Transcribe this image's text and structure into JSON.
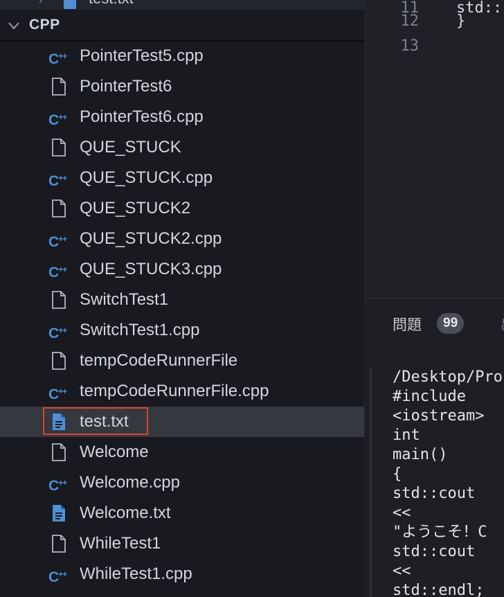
{
  "explorer": {
    "top_item": {
      "label": "test.txt"
    },
    "section": {
      "title": "CPP"
    },
    "files": [
      {
        "label": "PointerTest5.cpp",
        "icon": "cpp-icon"
      },
      {
        "label": "PointerTest6",
        "icon": "file-icon"
      },
      {
        "label": "PointerTest6.cpp",
        "icon": "cpp-icon"
      },
      {
        "label": "QUE_STUCK",
        "icon": "file-icon"
      },
      {
        "label": "QUE_STUCK.cpp",
        "icon": "cpp-icon"
      },
      {
        "label": "QUE_STUCK2",
        "icon": "file-icon"
      },
      {
        "label": "QUE_STUCK2.cpp",
        "icon": "cpp-icon"
      },
      {
        "label": "QUE_STUCK3.cpp",
        "icon": "cpp-icon"
      },
      {
        "label": "SwitchTest1",
        "icon": "file-icon"
      },
      {
        "label": "SwitchTest1.cpp",
        "icon": "cpp-icon"
      },
      {
        "label": "tempCodeRunnerFile",
        "icon": "file-icon"
      },
      {
        "label": "tempCodeRunnerFile.cpp",
        "icon": "cpp-icon"
      },
      {
        "label": "test.txt",
        "icon": "text-file-icon",
        "selected": true
      },
      {
        "label": "Welcome",
        "icon": "file-icon"
      },
      {
        "label": "Welcome.cpp",
        "icon": "cpp-icon"
      },
      {
        "label": "Welcome.txt",
        "icon": "text-file-icon"
      },
      {
        "label": "WhileTest1",
        "icon": "file-icon"
      },
      {
        "label": "WhileTest1.cpp",
        "icon": "cpp-icon"
      }
    ]
  },
  "editor": {
    "lines": [
      {
        "num": "11",
        "code": "std::"
      },
      {
        "num": "12",
        "code": "}"
      },
      {
        "num": "13",
        "code": ""
      }
    ]
  },
  "panel": {
    "tab_label": "問題",
    "badge": "99",
    "tab2_label": "出",
    "terminal_lines": [
      "/Desktop/Pro",
      "#include",
      "<iostream>",
      "int",
      "main()",
      "{",
      "std::cout",
      "<<",
      "\"ようこそ！C",
      "std::cout",
      "<<",
      "std::endl;"
    ]
  },
  "colors": {
    "accent_blue": "#4e8fd6",
    "selection_border": "#d9452f",
    "selected_row": "#35383f"
  }
}
